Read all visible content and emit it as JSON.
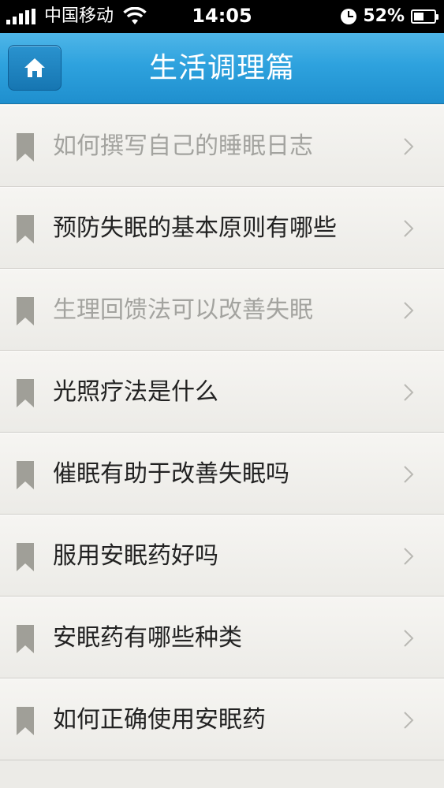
{
  "status_bar": {
    "carrier": "中国移动",
    "time": "14:05",
    "battery_percent_label": "52%",
    "battery_level": 0.52,
    "icons": [
      "signal-icon",
      "wifi-icon",
      "alarm-clock-icon",
      "battery-icon"
    ]
  },
  "nav": {
    "title": "生活调理篇",
    "home_icon": "home-icon"
  },
  "colors": {
    "nav_bar": "#2ea2de",
    "list_background": "#ecebe7",
    "text_unread": "#222222",
    "text_read": "#a3a39f",
    "bookmark": "#a09f98"
  },
  "list": {
    "items": [
      {
        "label": "如何撰写自己的睡眠日志",
        "read": true
      },
      {
        "label": "预防失眠的基本原则有哪些",
        "read": false
      },
      {
        "label": "生理回馈法可以改善失眠",
        "read": true
      },
      {
        "label": "光照疗法是什么",
        "read": false
      },
      {
        "label": "催眠有助于改善失眠吗",
        "read": false
      },
      {
        "label": "服用安眠药好吗",
        "read": false
      },
      {
        "label": "安眠药有哪些种类",
        "read": false
      },
      {
        "label": "如何正确使用安眠药",
        "read": false
      }
    ]
  }
}
